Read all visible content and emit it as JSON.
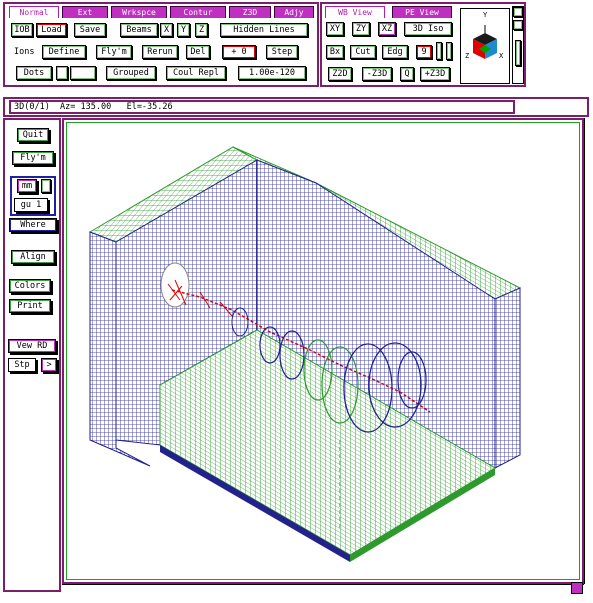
{
  "tabs_left": [
    "Normal",
    "Ext",
    "Wrkspce",
    "Contur",
    "Z3D",
    "Adjy"
  ],
  "tabs_right": [
    "WB View",
    "PE View"
  ],
  "toolbar": {
    "iob_label": "IOB",
    "load": "Load",
    "save": "Save",
    "beams_label": "Beams",
    "axis_x": "X",
    "axis_y": "Y",
    "axis_z": "Z",
    "hidden_lines": "Hidden Lines",
    "ions_label": "Ions",
    "define": "Define",
    "flym": "Fly'm",
    "rerun": "Rerun",
    "del": "Del",
    "plus_zero": "+ 0",
    "step": "Step",
    "dots": "Dots",
    "grouped": "Grouped",
    "coul_repl": "Coul Repl",
    "coul_value": "1.00e-120"
  },
  "view_controls": {
    "xy": "XY",
    "zy": "ZY",
    "xz": "XZ",
    "iso": "3D Iso",
    "bx": "Bx",
    "cut": "Cut",
    "edg": "Edg",
    "nine": "9",
    "z2d": "Z2D",
    "minus_z3d": "-Z3D",
    "q": "Q",
    "plus_z3d": "+Z3D"
  },
  "orientation": {
    "y": "Y",
    "z": "Z",
    "x": "X"
  },
  "status": {
    "text": "3D(0/1)  Az= 135.00   El=-35.26"
  },
  "sidebar": {
    "quit": "Quit",
    "flym": "Fly'm",
    "mm": "mm",
    "gu": "gu 1",
    "where": "Where",
    "align": "Align",
    "colors": "Colors",
    "print": "Print",
    "vew_rd": "Vew RD",
    "stp": "Stp",
    "next": ">"
  },
  "colors": {
    "frame": "#7a1f6a",
    "tab": "#c030c0",
    "grid_green": "#2e9a2e",
    "grid_blue": "#22228c",
    "trajectory_red": "#e00000"
  }
}
